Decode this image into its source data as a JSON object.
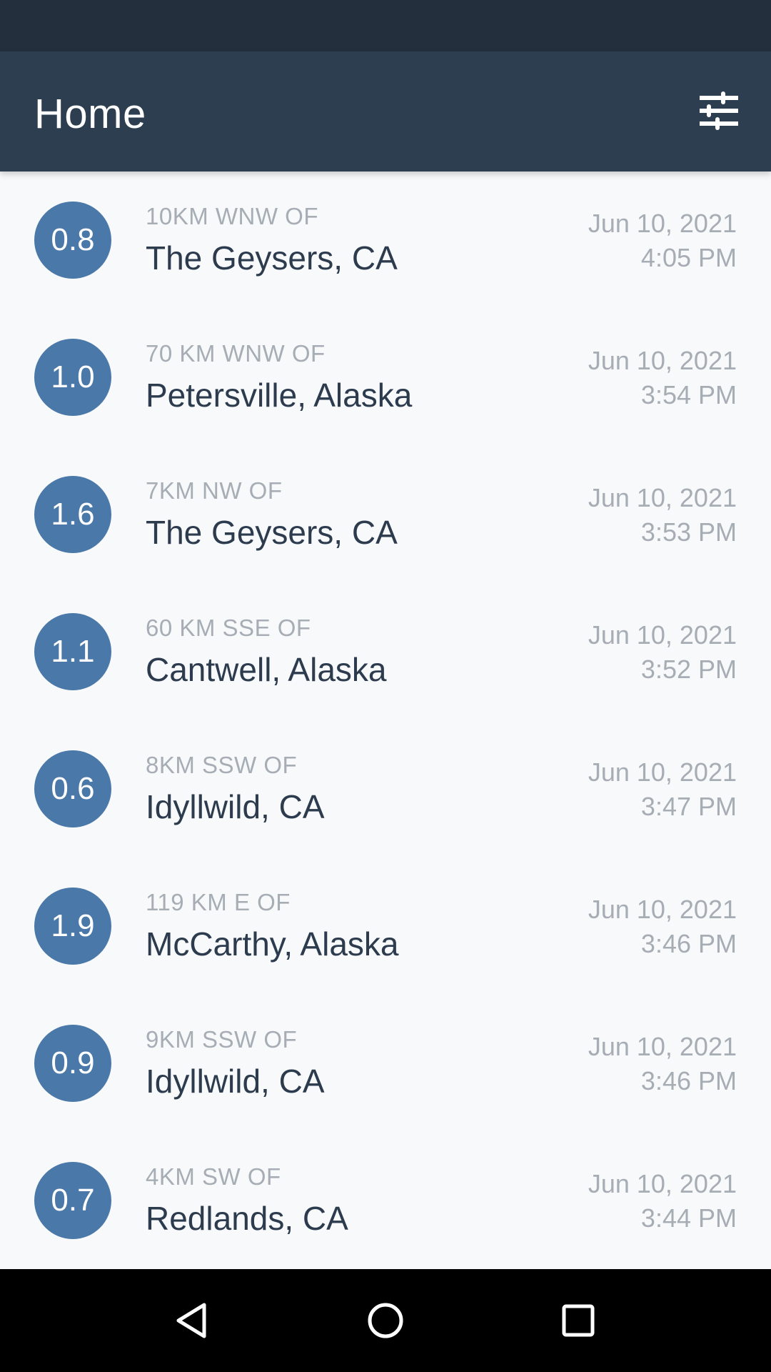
{
  "app_bar": {
    "title": "Home",
    "filter_icon": "sliders-icon"
  },
  "earthquakes": [
    {
      "magnitude": "0.8",
      "offset": "10KM WNW OF",
      "place": "The Geysers, CA",
      "date": "Jun 10, 2021",
      "time": "4:05 PM"
    },
    {
      "magnitude": "1.0",
      "offset": "70 KM WNW OF",
      "place": "Petersville, Alaska",
      "date": "Jun 10, 2021",
      "time": "3:54 PM"
    },
    {
      "magnitude": "1.6",
      "offset": "7KM NW OF",
      "place": "The Geysers, CA",
      "date": "Jun 10, 2021",
      "time": "3:53 PM"
    },
    {
      "magnitude": "1.1",
      "offset": "60 KM SSE OF",
      "place": "Cantwell, Alaska",
      "date": "Jun 10, 2021",
      "time": "3:52 PM"
    },
    {
      "magnitude": "0.6",
      "offset": "8KM SSW OF",
      "place": "Idyllwild, CA",
      "date": "Jun 10, 2021",
      "time": "3:47 PM"
    },
    {
      "magnitude": "1.9",
      "offset": "119 KM E OF",
      "place": "McCarthy, Alaska",
      "date": "Jun 10, 2021",
      "time": "3:46 PM"
    },
    {
      "magnitude": "0.9",
      "offset": "9KM SSW OF",
      "place": "Idyllwild, CA",
      "date": "Jun 10, 2021",
      "time": "3:46 PM"
    },
    {
      "magnitude": "0.7",
      "offset": "4KM SW OF",
      "place": "Redlands, CA",
      "date": "Jun 10, 2021",
      "time": "3:44 PM"
    }
  ],
  "nav_bar": {
    "back_icon": "back-triangle-icon",
    "home_icon": "home-circle-icon",
    "recents_icon": "recents-square-icon"
  },
  "colors": {
    "status_bar": "#232f3c",
    "app_bar": "#2c3e50",
    "magnitude_badge": "#4a78a8",
    "background": "#f8f9fa",
    "primary_text": "#2c3b4d",
    "secondary_text": "#a7adb5"
  }
}
